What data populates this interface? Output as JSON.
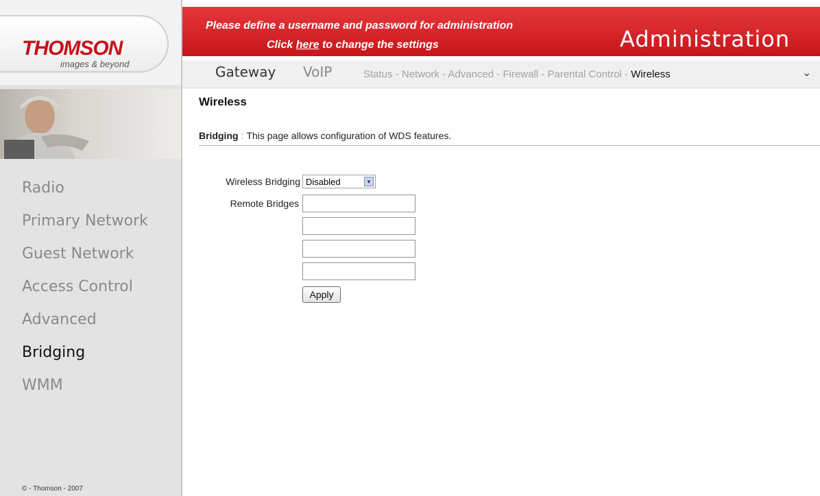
{
  "brand": {
    "logo": "THOMSON",
    "tagline": "images & beyond"
  },
  "banner": {
    "line1": "Please define a username and password for administration",
    "line2_prefix": "Click",
    "line2_link": "here",
    "line2_suffix": "to change the settings",
    "title": "Administration"
  },
  "topnav": {
    "tabs": [
      "Gateway",
      "VoIP"
    ],
    "subtabs": [
      "Status",
      "Network",
      "Advanced",
      "Firewall",
      "Parental Control",
      "Wireless"
    ],
    "separator": "-",
    "active_subtab": "Wireless"
  },
  "sidebar": {
    "items": [
      "Radio",
      "Primary Network",
      "Guest Network",
      "Access Control",
      "Advanced",
      "Bridging",
      "WMM"
    ],
    "active": "Bridging",
    "copyright": "© - Thomson - 2007"
  },
  "main": {
    "title": "Wireless",
    "desc_label": "Bridging",
    "desc_sep": ":",
    "desc_text": "This page allows configuration of WDS features.",
    "form": {
      "bridging_label": "Wireless Bridging",
      "bridging_value": "Disabled",
      "remote_label": "Remote Bridges",
      "remote_values": [
        "",
        "",
        "",
        ""
      ],
      "apply_label": "Apply"
    }
  },
  "colors": {
    "brand_red": "#c8161c",
    "sidebar_bg": "#e4e3e3"
  },
  "icons": {
    "select_arrow": "chevron-down-icon",
    "topnav_scroll": "chevron-down-icon"
  }
}
